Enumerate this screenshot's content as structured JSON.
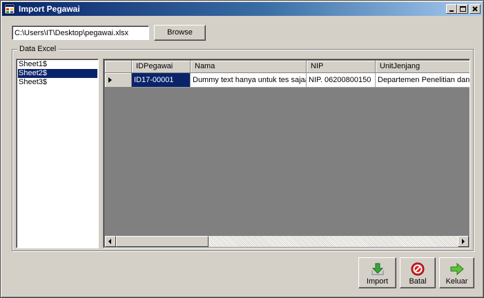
{
  "window": {
    "title": "Import Pegawai"
  },
  "file": {
    "path": "C:\\Users\\IT\\Desktop\\pegawai.xlsx",
    "browse_label": "Browse"
  },
  "group": {
    "label": "Data Excel"
  },
  "sheets": [
    "Sheet1$",
    "Sheet2$",
    "Sheet3$"
  ],
  "selected_sheet": "Sheet2$",
  "grid": {
    "columns": [
      "IDPegawai",
      "Nama",
      "NIP",
      "UnitJenjang"
    ],
    "rows": [
      [
        "ID17-00001",
        "Dummy text hanya untuk tes sajaa",
        "NIP. 06200800150",
        "Departemen Penelitian dan"
      ]
    ]
  },
  "buttons": {
    "import": "Import",
    "batal": "Batal",
    "keluar": "Keluar"
  },
  "icons": {
    "app": "app-window-icon",
    "import": "download-arrow-icon",
    "batal": "cancel-icon",
    "keluar": "arrow-right-icon"
  },
  "colors": {
    "title_start": "#0a246a",
    "title_end": "#a6caf0",
    "selection": "#0a246a",
    "grid_background": "#808080",
    "window_face": "#d4d0c8"
  }
}
